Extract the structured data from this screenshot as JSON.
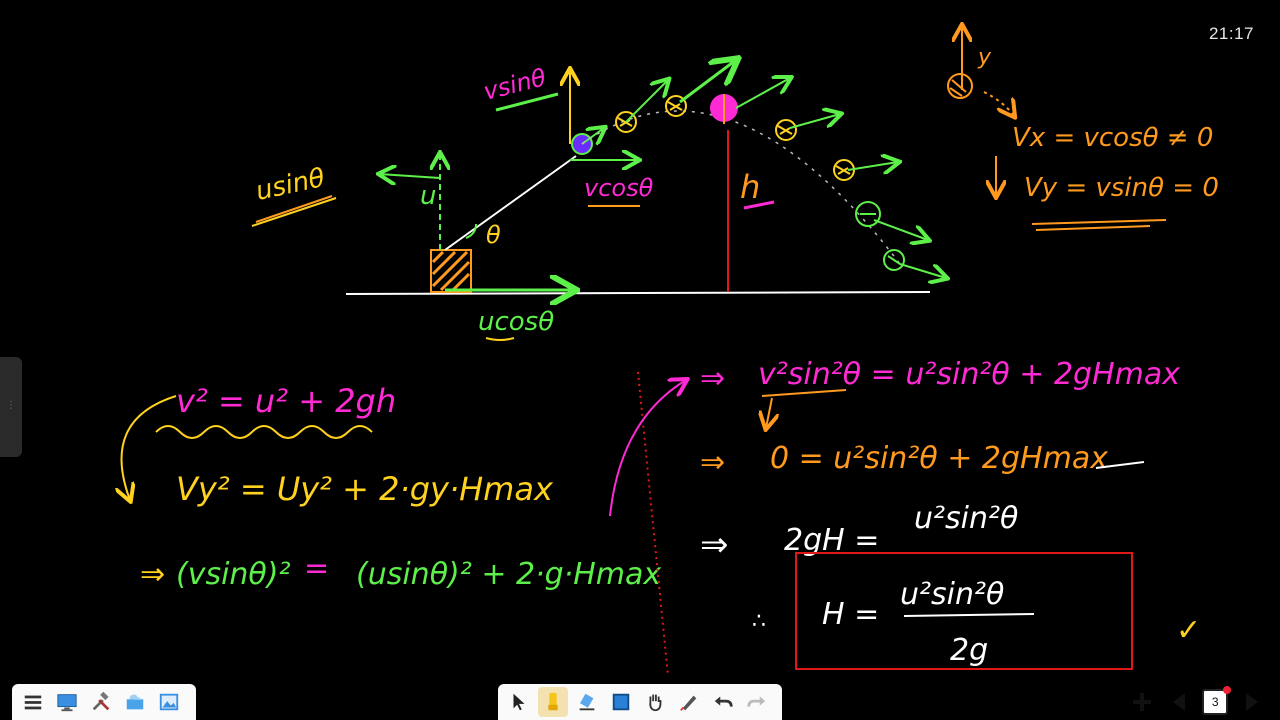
{
  "status_bar": {
    "clock": "21:17"
  },
  "diagram": {
    "labels": {
      "vsin": "vsinθ",
      "usin": "usinθ",
      "u": "u",
      "theta": "θ",
      "vcos": "vcosθ",
      "ucos": "ucosθ",
      "h": "h",
      "y_axis": "y"
    },
    "side_notes": {
      "vx": "Vx = vcosθ ≠ 0",
      "vy": "Vy = vsinθ = 0"
    }
  },
  "equations": {
    "eq1": "v² = u² + 2gh",
    "eq2": "Vy² = Uy² + 2·gy·Hmax",
    "eq3_arrow": "⇒",
    "eq3_left": "(vsinθ)²",
    "eq3_eq": "=",
    "eq3_right": "(usinθ)² + 2·g·Hmax",
    "r1_arrow": "⇒",
    "r1": "v²sin²θ = u²sin²θ + 2gHmax",
    "r2_arrow": "⇒",
    "r2": "0 = u²sin²θ + 2gHmax",
    "r3_arrow": "⇒",
    "r3_left": "2gH =",
    "r3_right": "u²sin²θ",
    "therefore": "∴",
    "boxed_left": "H =",
    "boxed_num": "u²sin²θ",
    "boxed_den": "2g",
    "tick": "✓"
  },
  "colors": {
    "green": "#5ef04a",
    "magenta": "#ff2ad4",
    "orange": "#ff9a1f",
    "yellow": "#ffd21f",
    "red": "#e01818",
    "white": "#ffffff"
  },
  "toolbar": {
    "left": [
      {
        "icon": "menu-icon"
      },
      {
        "icon": "monitor-icon"
      },
      {
        "icon": "tools-icon"
      },
      {
        "icon": "cloud-folder-icon"
      },
      {
        "icon": "image-icon"
      }
    ],
    "middle": [
      {
        "icon": "pointer-icon"
      },
      {
        "icon": "highlighter-icon"
      },
      {
        "icon": "eraser-icon"
      },
      {
        "icon": "square-icon"
      },
      {
        "icon": "hand-icon"
      },
      {
        "icon": "smart-pen-icon"
      },
      {
        "icon": "undo-icon"
      },
      {
        "icon": "redo-icon"
      }
    ],
    "right": {
      "page_number": "3"
    }
  }
}
